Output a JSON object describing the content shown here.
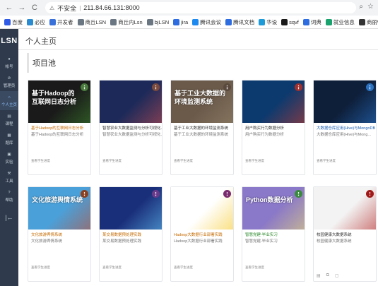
{
  "browser": {
    "back": "←",
    "forward": "→",
    "reload": "C",
    "security": "不安全",
    "address": "211.84.66.131:8000",
    "bookmarks": [
      {
        "label": "百度",
        "color": "#2f5be7"
      },
      {
        "label": "必应",
        "color": "#2a8bd1"
      },
      {
        "label": "开发者",
        "color": "#3a71d8"
      },
      {
        "label": "商丘LSN",
        "color": "#6b7683"
      },
      {
        "label": "商丘内Lsn",
        "color": "#6b7683"
      },
      {
        "label": "bjLSN",
        "color": "#6b7683"
      },
      {
        "label": "jira",
        "color": "#2d6de0"
      },
      {
        "label": "腾讯会议",
        "color": "#1e8af0"
      },
      {
        "label": "腾讯文档",
        "color": "#2d6de0"
      },
      {
        "label": "华设",
        "color": "#1d9bd8"
      },
      {
        "label": "sqvf",
        "color": "#1a1a1a"
      },
      {
        "label": "词典",
        "color": "#2d6de0"
      },
      {
        "label": "就业信息",
        "color": "#1aa36e"
      },
      {
        "label": "商丽Wind",
        "color": "#333"
      }
    ]
  },
  "rail": {
    "logo": "LSN",
    "items": [
      {
        "label": "帐号"
      },
      {
        "label": "管理员"
      },
      {
        "label": "个人主页",
        "active": true
      },
      {
        "label": "课程"
      },
      {
        "label": "题库"
      },
      {
        "label": "实验"
      },
      {
        "label": "工具"
      },
      {
        "label": "帮助"
      }
    ],
    "collapse": "|←"
  },
  "main": {
    "title": "个人主页",
    "section": "项目池"
  },
  "cards": [
    {
      "caption": "基于Hadoop的\n互联网日志分析",
      "title": "基于Hadoop的互联网日志分析",
      "subtitle": "基于Hadoop的互联网日志分析",
      "link": "查看学生进度",
      "bg": "#1a1a1a",
      "accent": "#3f8a2e",
      "more_color": "#4a7a3e",
      "title_color": "orange"
    },
    {
      "caption": "",
      "title": "智慧农业大数据监测与分析可视化...",
      "subtitle": "智慧农业大数据监测与分析可视化...",
      "link": "查看学生进度",
      "bg": "#1d2a59",
      "accent": "#d05050",
      "more_color": "#7a4a3e",
      "title_color": "dark"
    },
    {
      "caption": "基于工业大数据的\n环境监测系统",
      "title": "基于工业大数据的环境监测系统",
      "subtitle": "基于工业大数据的环境监测系统",
      "link": "查看学生进度",
      "bg": "#6b5a4a",
      "accent": "#9a8a70",
      "more_color": "#5a4a3e",
      "title_color": "dark"
    },
    {
      "caption": "",
      "title": "用户购买行为数据分析",
      "subtitle": "用户购买行为数据分析",
      "link": "查看学生进度",
      "bg": "#0c3a6e",
      "accent": "#d23a2a",
      "more_color": "#a03030",
      "title_color": "dark"
    },
    {
      "caption": "",
      "title": "大数据仓库应用(Hive)与MongoDB",
      "subtitle": "大数据仓库应用(Hive)与Mong...",
      "link": "查看学生进度",
      "bg": "#0e1f3a",
      "accent": "#2a7ad6",
      "more_color": "#2a72c0",
      "title_color": "blue"
    },
    {
      "caption": "文化旅游舆情系统",
      "title": "文化旅游舆情系统",
      "subtitle": "文化旅游舆情系统",
      "link": "查看学生进度",
      "bg": "#4aa0d9",
      "accent": "#c94a2a",
      "more_color": "#8a4020",
      "title_color": "orange"
    },
    {
      "caption": "",
      "title": "某交易数据预处理实践",
      "subtitle": "某交易数据预处理实践",
      "link": "查看学生进度",
      "bg": "#1a2f7a",
      "accent": "#6ad0ff",
      "more_color": "#6a3a8a",
      "title_color": "orange"
    },
    {
      "caption": "",
      "title": "Hadoop大数据行业部署实践",
      "subtitle": "Hadoop大数据行业部署实践",
      "link": "查看学生进度",
      "bg": "#ffffff",
      "accent": "#f5c518",
      "more_color": "#7a2a6e",
      "title_color": "orange"
    },
    {
      "caption": "Python数据分析",
      "title": "智慧党建-毕业实习",
      "subtitle": "智慧党建-毕业实习",
      "link": "查看学生进度",
      "bg": "#8a78c8",
      "accent": "#f0e070",
      "more_color": "#3a8a3e",
      "title_color": "green"
    },
    {
      "caption": "",
      "title": "校园健康大数据系统",
      "subtitle": "校园健康大数据系统",
      "link": "",
      "bg": "#f3f3f3",
      "accent": "#b01818",
      "more_color": "#a01818",
      "title_color": "dark"
    }
  ]
}
